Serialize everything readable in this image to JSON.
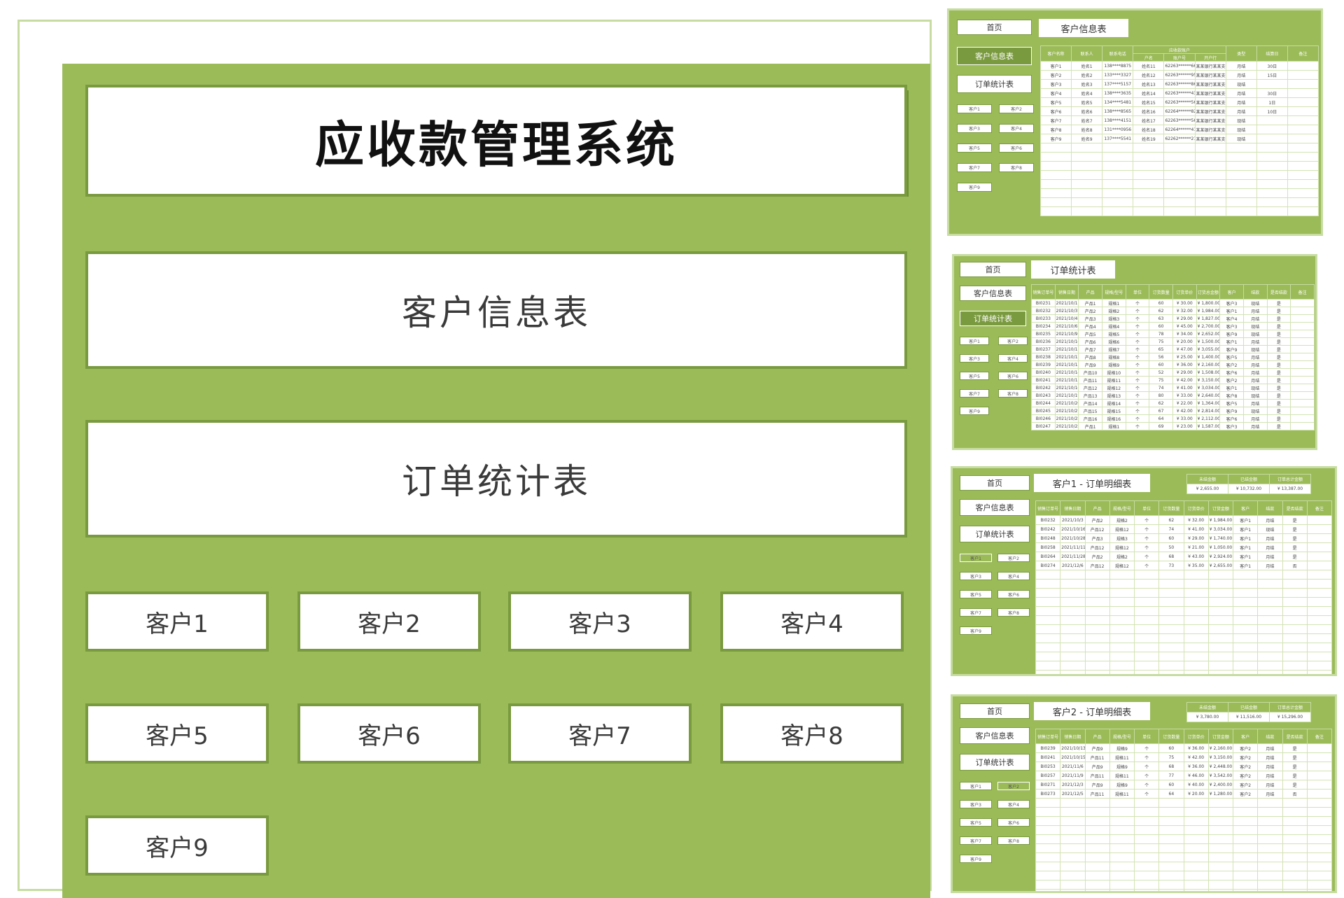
{
  "colors": {
    "panel": "#9bbb59",
    "panel_dark": "#7a9a3f",
    "frame": "#c6dca1"
  },
  "main": {
    "title": "应收款管理系统",
    "btn_customer_info": "客户信息表",
    "btn_order_stats": "订单统计表",
    "customers": [
      "客户1",
      "客户2",
      "客户3",
      "客户4",
      "客户5",
      "客户6",
      "客户7",
      "客户8",
      "客户9"
    ]
  },
  "thumb_customer": {
    "home": "首页",
    "title": "客户信息表",
    "nav_customer_info": "客户信息表",
    "nav_order_stats": "订单统计表",
    "group_header": "应收款账户",
    "headers": [
      "客户名称",
      "联系人",
      "联系电话",
      "户名",
      "账户号",
      "开户行",
      "类型",
      "结算日",
      "备注"
    ],
    "rows": [
      [
        "客户1",
        "姓名1",
        "138****8875",
        "姓名11",
        "62263******6658",
        "某某银行某某支行1",
        "月结",
        "30日",
        ""
      ],
      [
        "客户2",
        "姓名2",
        "133****3327",
        "姓名12",
        "62263******9563",
        "某某银行某某支行2",
        "月结",
        "15日",
        ""
      ],
      [
        "客户3",
        "姓名3",
        "137****5157",
        "姓名13",
        "62263******8645",
        "某某银行某某支行3",
        "现结",
        "",
        ""
      ],
      [
        "客户4",
        "姓名4",
        "138****3635",
        "姓名14",
        "62263******4324",
        "某某银行某某支行4",
        "月结",
        "30日",
        ""
      ],
      [
        "客户5",
        "姓名5",
        "134****5481",
        "姓名15",
        "62263******5673",
        "某某银行某某支行5",
        "月结",
        "1日",
        ""
      ],
      [
        "客户6",
        "姓名6",
        "138****8565",
        "姓名16",
        "62264******8260",
        "某某银行某某支行6",
        "月结",
        "10日",
        ""
      ],
      [
        "客户7",
        "姓名7",
        "138****4151",
        "姓名17",
        "62263******5698",
        "某某银行某某支行7",
        "现结",
        "",
        ""
      ],
      [
        "客户8",
        "姓名8",
        "131****0956",
        "姓名18",
        "62264******4127",
        "某某银行某某支行8",
        "现结",
        "",
        ""
      ],
      [
        "客户9",
        "姓名9",
        "137****5541",
        "姓名19",
        "62262******2147",
        "某某银行某某支行9",
        "现结",
        "",
        ""
      ]
    ]
  },
  "thumb_orders": {
    "home": "首页",
    "title": "订单统计表",
    "nav_customer_info": "客户信息表",
    "nav_order_stats": "订单统计表",
    "headers": [
      "销售订单号",
      "销售日期",
      "产品",
      "规格/型号",
      "单位",
      "订货数量",
      "订货单价",
      "订货总金额",
      "客户",
      "结款",
      "是否结款",
      "备注"
    ],
    "rows": [
      [
        "BI0231",
        "2021/10/1",
        "产品1",
        "规格1",
        "个",
        "60",
        "¥ 30.00",
        "¥ 1,800.00",
        "客户3",
        "现结",
        "是",
        ""
      ],
      [
        "BI0232",
        "2021/10/3",
        "产品2",
        "规格2",
        "个",
        "62",
        "¥ 32.00",
        "¥ 1,984.00",
        "客户1",
        "月结",
        "是",
        ""
      ],
      [
        "BI0233",
        "2021/10/4",
        "产品3",
        "规格3",
        "个",
        "63",
        "¥ 29.00",
        "¥ 1,827.00",
        "客户4",
        "月结",
        "是",
        ""
      ],
      [
        "BI0234",
        "2021/10/6",
        "产品4",
        "规格4",
        "个",
        "60",
        "¥ 45.00",
        "¥ 2,700.00",
        "客户3",
        "现结",
        "是",
        ""
      ],
      [
        "BI0235",
        "2021/10/9",
        "产品5",
        "规格5",
        "个",
        "78",
        "¥ 34.00",
        "¥ 2,652.00",
        "客户9",
        "现结",
        "是",
        ""
      ],
      [
        "BI0236",
        "2021/10/10",
        "产品6",
        "规格6",
        "个",
        "75",
        "¥ 20.00",
        "¥ 1,500.00",
        "客户1",
        "月结",
        "是",
        ""
      ],
      [
        "BI0237",
        "2021/10/11",
        "产品7",
        "规格7",
        "个",
        "65",
        "¥ 47.00",
        "¥ 3,055.00",
        "客户9",
        "现结",
        "是",
        ""
      ],
      [
        "BI0238",
        "2021/10/12",
        "产品8",
        "规格8",
        "个",
        "56",
        "¥ 25.00",
        "¥ 1,400.00",
        "客户5",
        "月结",
        "是",
        ""
      ],
      [
        "BI0239",
        "2021/10/13",
        "产品9",
        "规格9",
        "个",
        "60",
        "¥ 36.00",
        "¥ 2,160.00",
        "客户2",
        "月结",
        "是",
        ""
      ],
      [
        "BI0240",
        "2021/10/14",
        "产品10",
        "规格10",
        "个",
        "52",
        "¥ 29.00",
        "¥ 1,508.00",
        "客户6",
        "月结",
        "是",
        ""
      ],
      [
        "BI0241",
        "2021/10/15",
        "产品11",
        "规格11",
        "个",
        "75",
        "¥ 42.00",
        "¥ 3,150.00",
        "客户2",
        "月结",
        "是",
        ""
      ],
      [
        "BI0242",
        "2021/10/16",
        "产品12",
        "规格12",
        "个",
        "74",
        "¥ 41.00",
        "¥ 3,034.00",
        "客户1",
        "现结",
        "是",
        ""
      ],
      [
        "BI0243",
        "2021/10/19",
        "产品13",
        "规格13",
        "个",
        "80",
        "¥ 33.00",
        "¥ 2,640.00",
        "客户8",
        "现结",
        "是",
        ""
      ],
      [
        "BI0244",
        "2021/10/20",
        "产品14",
        "规格14",
        "个",
        "62",
        "¥ 22.00",
        "¥ 1,364.00",
        "客户5",
        "月结",
        "是",
        ""
      ],
      [
        "BI0245",
        "2021/10/21",
        "产品15",
        "规格15",
        "个",
        "67",
        "¥ 42.00",
        "¥ 2,814.00",
        "客户9",
        "现结",
        "是",
        ""
      ],
      [
        "BI0246",
        "2021/10/22",
        "产品16",
        "规格16",
        "个",
        "64",
        "¥ 33.00",
        "¥ 2,112.00",
        "客户6",
        "月结",
        "是",
        ""
      ],
      [
        "BI0247",
        "2021/10/23",
        "产品1",
        "规格1",
        "个",
        "69",
        "¥ 23.00",
        "¥ 1,587.00",
        "客户3",
        "月结",
        "是",
        ""
      ]
    ]
  },
  "thumb_c1": {
    "home": "首页",
    "title": "客户1 - 订单明细表",
    "nav_customer_info": "客户信息表",
    "nav_order_stats": "订单统计表",
    "summary_headers": [
      "未结金额",
      "已结金额",
      "订单总计金额"
    ],
    "summary_values": [
      "¥ 2,655.00",
      "¥ 10,732.00",
      "¥ 13,387.00"
    ],
    "headers": [
      "销售订单号",
      "销售日期",
      "产品",
      "规格/型号",
      "单位",
      "订货数量",
      "订货单价",
      "订货金额",
      "客户",
      "结款",
      "是否结款",
      "备注"
    ],
    "rows": [
      [
        "BI0232",
        "2021/10/3",
        "产品2",
        "规格2",
        "个",
        "62",
        "¥ 32.00",
        "¥ 1,984.00",
        "客户1",
        "月结",
        "是",
        ""
      ],
      [
        "BI0242",
        "2021/10/16",
        "产品12",
        "规格12",
        "个",
        "74",
        "¥ 41.00",
        "¥ 3,034.00",
        "客户1",
        "现结",
        "是",
        ""
      ],
      [
        "BI0248",
        "2021/10/28",
        "产品3",
        "规格3",
        "个",
        "60",
        "¥ 29.00",
        "¥ 1,740.00",
        "客户1",
        "月结",
        "是",
        ""
      ],
      [
        "BI0258",
        "2021/11/11",
        "产品12",
        "规格12",
        "个",
        "50",
        "¥ 21.00",
        "¥ 1,050.00",
        "客户1",
        "月结",
        "是",
        ""
      ],
      [
        "BI0264",
        "2021/11/28",
        "产品2",
        "规格2",
        "个",
        "68",
        "¥ 43.00",
        "¥ 2,924.00",
        "客户1",
        "月结",
        "是",
        ""
      ],
      [
        "BI0274",
        "2021/12/6",
        "产品12",
        "规格12",
        "个",
        "73",
        "¥ 35.00",
        "¥ 2,655.00",
        "客户1",
        "月结",
        "否",
        ""
      ]
    ]
  },
  "thumb_c2": {
    "home": "首页",
    "title": "客户2 - 订单明细表",
    "nav_customer_info": "客户信息表",
    "nav_order_stats": "订单统计表",
    "summary_headers": [
      "未结金额",
      "已结金额",
      "订单总计金额"
    ],
    "summary_values": [
      "¥ 3,780.00",
      "¥ 11,516.00",
      "¥ 15,296.00"
    ],
    "headers": [
      "销售订单号",
      "销售日期",
      "产品",
      "规格/型号",
      "单位",
      "订货数量",
      "订货单价",
      "订货金额",
      "客户",
      "结款",
      "是否结款",
      "备注"
    ],
    "rows": [
      [
        "BI0239",
        "2021/10/13",
        "产品9",
        "规格9",
        "个",
        "60",
        "¥ 36.00",
        "¥ 2,160.00",
        "客户2",
        "月结",
        "是",
        ""
      ],
      [
        "BI0241",
        "2021/10/15",
        "产品11",
        "规格11",
        "个",
        "75",
        "¥ 42.00",
        "¥ 3,150.00",
        "客户2",
        "月结",
        "是",
        ""
      ],
      [
        "BI0253",
        "2021/11/6",
        "产品9",
        "规格9",
        "个",
        "68",
        "¥ 36.00",
        "¥ 2,448.00",
        "客户2",
        "月结",
        "是",
        ""
      ],
      [
        "BI0257",
        "2021/11/9",
        "产品11",
        "规格11",
        "个",
        "77",
        "¥ 46.00",
        "¥ 3,542.00",
        "客户2",
        "月结",
        "是",
        ""
      ],
      [
        "BI0271",
        "2021/12/3",
        "产品9",
        "规格9",
        "个",
        "60",
        "¥ 40.00",
        "¥ 2,400.00",
        "客户2",
        "月结",
        "是",
        ""
      ],
      [
        "BI0273",
        "2021/12/5",
        "产品11",
        "规格11",
        "个",
        "64",
        "¥ 20.00",
        "¥ 1,280.00",
        "客户2",
        "月结",
        "否",
        ""
      ]
    ]
  }
}
